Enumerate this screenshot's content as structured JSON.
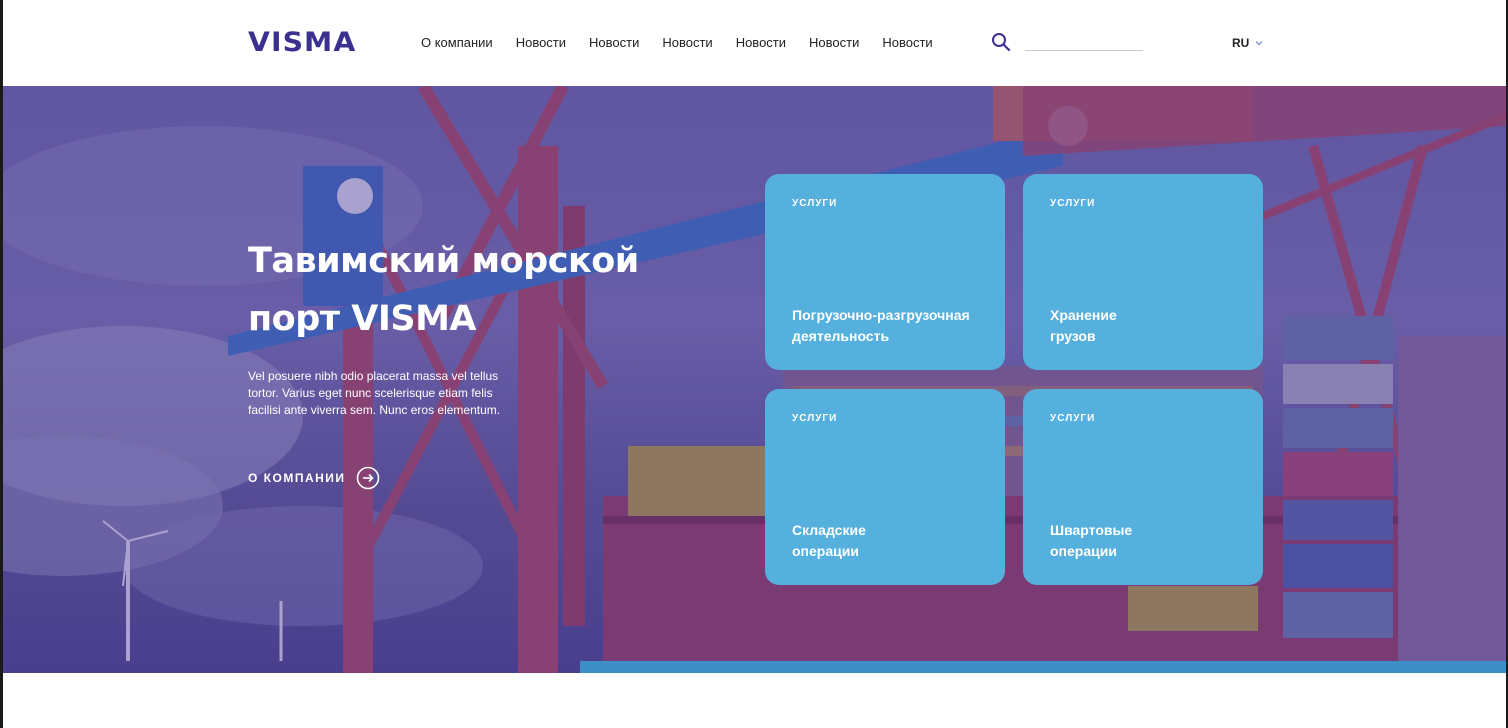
{
  "header": {
    "logo": "VISMA",
    "nav": [
      "О компании",
      "Новости",
      "Новости",
      "Новости",
      "Новости",
      "Новости",
      "Новости"
    ],
    "search": {
      "value": "",
      "placeholder": ""
    },
    "lang": "RU"
  },
  "hero": {
    "title_line1": "Тавимский морской",
    "title_line2": "порт VISMA",
    "description": "Vel posuere nibh odio placerat massa vel tellus tortor. Varius eget nunc scelerisque etiam felis facilisi ante viverra sem. Nunc eros elementum.",
    "about_label": "О КОМПАНИИ"
  },
  "cards": [
    {
      "tag": "УСЛУГИ",
      "line1": "Погрузочно-разгрузочная",
      "line2": "деятельность"
    },
    {
      "tag": "УСЛУГИ",
      "line1": "Хранение",
      "line2": "грузов"
    },
    {
      "tag": "УСЛУГИ",
      "line1": "Складские",
      "line2": "операции"
    },
    {
      "tag": "УСЛУГИ",
      "line1": "Швартовые",
      "line2": "операции"
    }
  ],
  "colors": {
    "brand": "#3b2f8f",
    "card": "#56b0de",
    "overlay": "#4634a0"
  },
  "icons": {
    "search": "search-icon",
    "lang_dropdown": "chevron-down-icon",
    "about_arrow": "arrow-right-circle-icon"
  }
}
